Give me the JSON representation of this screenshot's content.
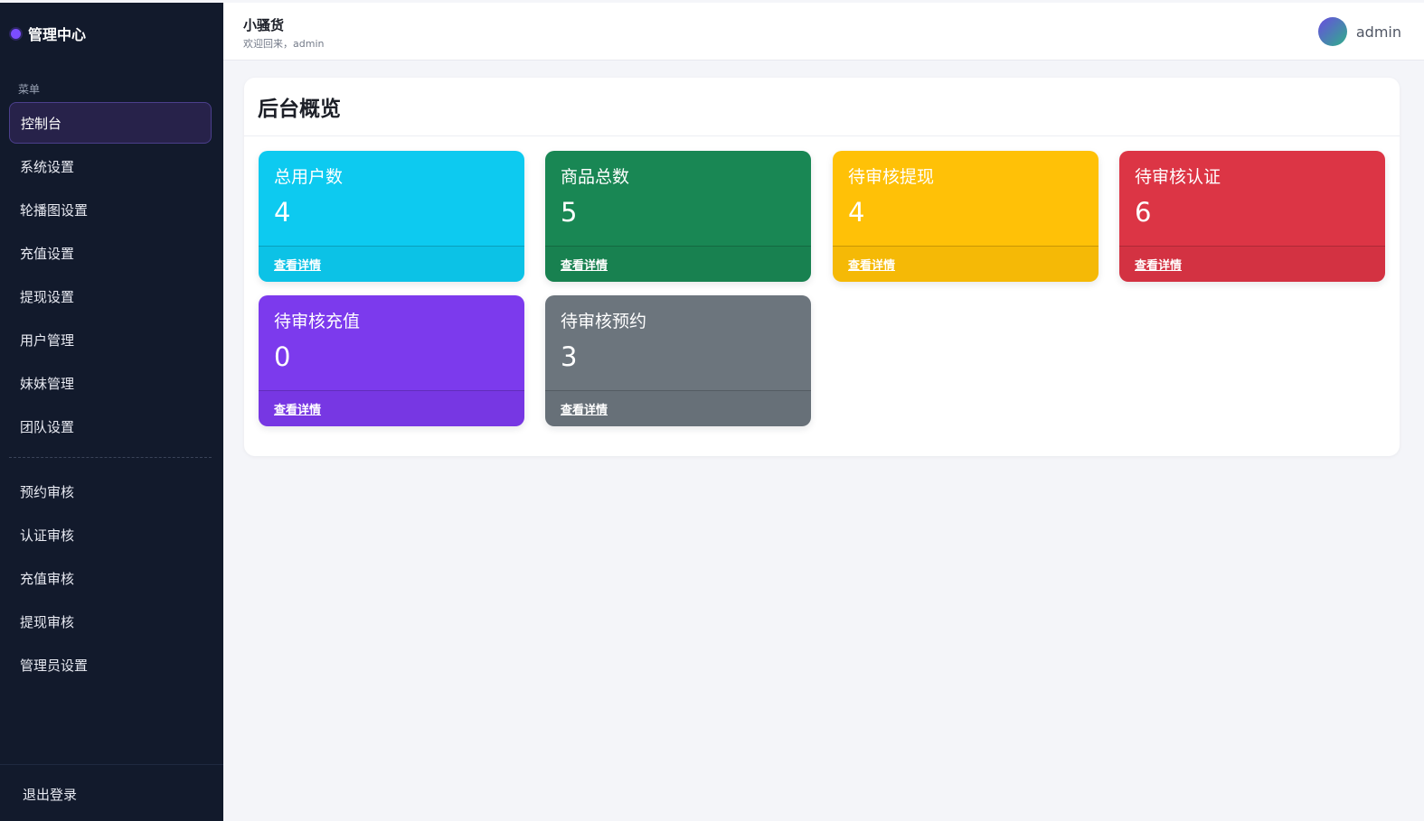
{
  "sidebar": {
    "brand": "管理中心",
    "menu_caption": "菜单",
    "items_group1": [
      {
        "label": "控制台",
        "active": true
      },
      {
        "label": "系统设置"
      },
      {
        "label": "轮播图设置"
      },
      {
        "label": "充值设置"
      },
      {
        "label": "提现设置"
      },
      {
        "label": "用户管理"
      },
      {
        "label": "妹妹管理"
      },
      {
        "label": "团队设置"
      }
    ],
    "items_group2": [
      {
        "label": "预约审核"
      },
      {
        "label": "认证审核"
      },
      {
        "label": "充值审核"
      },
      {
        "label": "提现审核"
      },
      {
        "label": "管理员设置"
      }
    ],
    "logout": "退出登录"
  },
  "header": {
    "title": "小骚货",
    "welcome": "欢迎回来，admin",
    "user_name": "admin"
  },
  "panel": {
    "title": "后台概览"
  },
  "cards": [
    {
      "label": "总用户数",
      "value": "4",
      "link": "查看详情",
      "color": "#0dcaf0"
    },
    {
      "label": "商品总数",
      "value": "5",
      "link": "查看详情",
      "color": "#198754"
    },
    {
      "label": "待审核提现",
      "value": "4",
      "link": "查看详情",
      "color": "#ffc107"
    },
    {
      "label": "待审核认证",
      "value": "6",
      "link": "查看详情",
      "color": "#dc3545"
    },
    {
      "label": "待审核充值",
      "value": "0",
      "link": "查看详情",
      "color": "#7c3aed"
    },
    {
      "label": "待审核预约",
      "value": "3",
      "link": "查看详情",
      "color": "#6c757d"
    }
  ]
}
